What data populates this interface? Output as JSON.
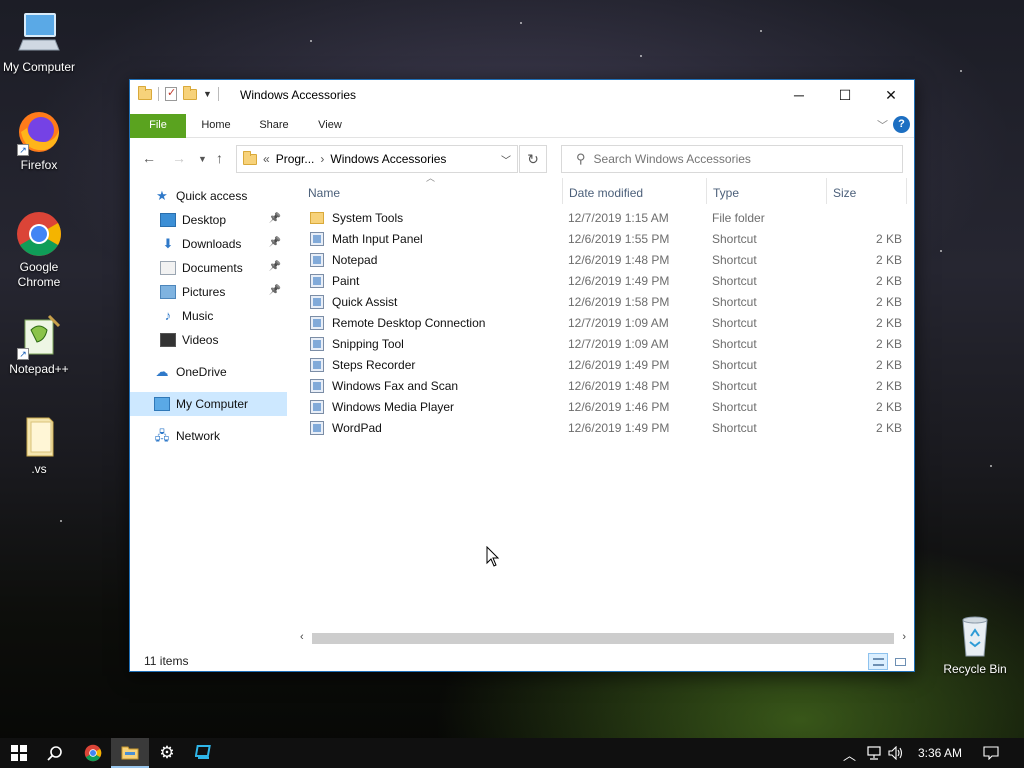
{
  "desktop": {
    "icons": [
      {
        "label": "My Computer",
        "icon": "computer-icon"
      },
      {
        "label": "Firefox",
        "icon": "firefox-icon"
      },
      {
        "label": "Google Chrome",
        "icon": "chrome-icon"
      },
      {
        "label": "Notepad++",
        "icon": "notepadpp-icon"
      },
      {
        "label": ".vs",
        "icon": "folder-icon"
      },
      {
        "label": "Recycle Bin",
        "icon": "recycle-bin-icon"
      }
    ]
  },
  "window": {
    "title": "Windows Accessories",
    "controls": {
      "minimize": "─",
      "maximize": "☐",
      "close": "✕"
    },
    "ribbon": {
      "tabs": [
        "File",
        "Home",
        "Share",
        "View"
      ],
      "help": "?"
    },
    "address": {
      "overflow": "«",
      "segments": [
        "Progr...",
        "Windows Accessories"
      ],
      "separator": "›"
    },
    "search": {
      "placeholder": "Search Windows Accessories"
    },
    "nav": {
      "items": [
        {
          "label": "Quick access",
          "icon": "star-icon",
          "pinned": false
        },
        {
          "label": "Desktop",
          "icon": "desktop-icon",
          "pinned": true
        },
        {
          "label": "Downloads",
          "icon": "downloads-icon",
          "pinned": true
        },
        {
          "label": "Documents",
          "icon": "documents-icon",
          "pinned": true
        },
        {
          "label": "Pictures",
          "icon": "pictures-icon",
          "pinned": true
        },
        {
          "label": "Music",
          "icon": "music-icon",
          "pinned": false
        },
        {
          "label": "Videos",
          "icon": "videos-icon",
          "pinned": false
        },
        {
          "label": "OneDrive",
          "icon": "cloud-icon",
          "pinned": false
        },
        {
          "label": "My Computer",
          "icon": "computer-icon",
          "pinned": false,
          "selected": true
        },
        {
          "label": "Network",
          "icon": "network-icon",
          "pinned": false
        }
      ]
    },
    "columns": {
      "name": "Name",
      "date": "Date modified",
      "type": "Type",
      "size": "Size"
    },
    "files": [
      {
        "name": "System Tools",
        "date": "12/7/2019 1:15 AM",
        "type": "File folder",
        "size": "",
        "icon": "folder-icon"
      },
      {
        "name": "Math Input Panel",
        "date": "12/6/2019 1:55 PM",
        "type": "Shortcut",
        "size": "2 KB",
        "icon": "math-input-icon"
      },
      {
        "name": "Notepad",
        "date": "12/6/2019 1:48 PM",
        "type": "Shortcut",
        "size": "2 KB",
        "icon": "notepad-icon"
      },
      {
        "name": "Paint",
        "date": "12/6/2019 1:49 PM",
        "type": "Shortcut",
        "size": "2 KB",
        "icon": "paint-icon"
      },
      {
        "name": "Quick Assist",
        "date": "12/6/2019 1:58 PM",
        "type": "Shortcut",
        "size": "2 KB",
        "icon": "quick-assist-icon"
      },
      {
        "name": "Remote Desktop Connection",
        "date": "12/7/2019 1:09 AM",
        "type": "Shortcut",
        "size": "2 KB",
        "icon": "remote-desktop-icon"
      },
      {
        "name": "Snipping Tool",
        "date": "12/7/2019 1:09 AM",
        "type": "Shortcut",
        "size": "2 KB",
        "icon": "snipping-tool-icon"
      },
      {
        "name": "Steps Recorder",
        "date": "12/6/2019 1:49 PM",
        "type": "Shortcut",
        "size": "2 KB",
        "icon": "steps-recorder-icon"
      },
      {
        "name": "Windows Fax and Scan",
        "date": "12/6/2019 1:48 PM",
        "type": "Shortcut",
        "size": "2 KB",
        "icon": "fax-scan-icon"
      },
      {
        "name": "Windows Media Player",
        "date": "12/6/2019 1:46 PM",
        "type": "Shortcut",
        "size": "2 KB",
        "icon": "media-player-icon"
      },
      {
        "name": "WordPad",
        "date": "12/6/2019 1:49 PM",
        "type": "Shortcut",
        "size": "2 KB",
        "icon": "wordpad-icon"
      }
    ],
    "status": {
      "count": "11 items"
    }
  },
  "taskbar": {
    "clock": "3:36 AM",
    "apps": [
      "start-icon",
      "search-icon",
      "chrome-icon",
      "file-explorer-icon",
      "settings-icon",
      "remote-icon"
    ]
  },
  "colors": {
    "file_tab": "#5aa31f",
    "selection": "#cde8ff",
    "accent": "#1d6fc2"
  }
}
